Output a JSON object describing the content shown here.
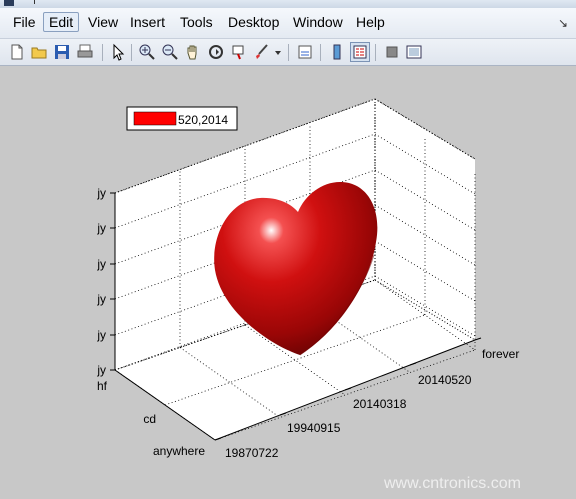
{
  "menu": {
    "file": "File",
    "edit": "Edit",
    "view": "View",
    "insert": "Insert",
    "tools": "Tools",
    "desktop": "Desktop",
    "window": "Window",
    "help": "Help"
  },
  "toolbar_icons": [
    "new-file-icon",
    "open-folder-icon",
    "save-icon",
    "print-icon",
    "pointer-icon",
    "zoom-in-icon",
    "zoom-out-icon",
    "pan-hand-icon",
    "rotate-3d-icon",
    "data-cursor-icon",
    "brush-icon",
    "brush-dropdown-icon",
    "link-plot-icon",
    "colorbar-icon",
    "legend-icon",
    "hide-plot-tools-icon",
    "show-plot-tools-icon"
  ],
  "legend": {
    "label": "520,2014",
    "color": "#ff0000"
  },
  "axes": {
    "z_ticks": [
      "jy",
      "jy",
      "jy",
      "jy",
      "jy",
      "jy"
    ],
    "y_ticks": [
      "hf",
      "cd",
      "anywhere"
    ],
    "x_ticks": [
      "19870722",
      "19940915",
      "20140318",
      "20140520",
      "forever"
    ]
  },
  "colors": {
    "surface": "#cc1010",
    "figure_bg": "#c8c8c8",
    "axes_bg": "#ffffff"
  },
  "watermark": "www.cntronics.com"
}
